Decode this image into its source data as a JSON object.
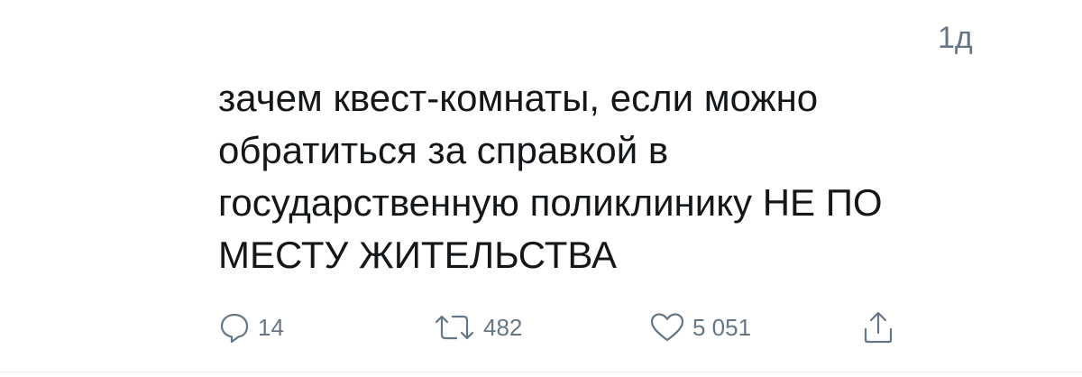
{
  "tweet": {
    "timestamp": "1д",
    "text_lines": [
      "зачем квест-комнаты, если можно",
      "обратиться за справкой в",
      "государственную поликлинику НЕ ПО",
      "МЕСТУ ЖИТЕЛЬСТВА"
    ]
  },
  "actions": {
    "reply": {
      "icon": "speech-bubble-icon",
      "count": "14"
    },
    "retweet": {
      "icon": "retweet-arrows-icon",
      "count": "482"
    },
    "like": {
      "icon": "heart-icon",
      "count": "5 051"
    },
    "share": {
      "icon": "share-upload-icon"
    }
  },
  "colors": {
    "text": "#14171a",
    "secondary": "#657786",
    "divider": "#e6ecf0"
  }
}
